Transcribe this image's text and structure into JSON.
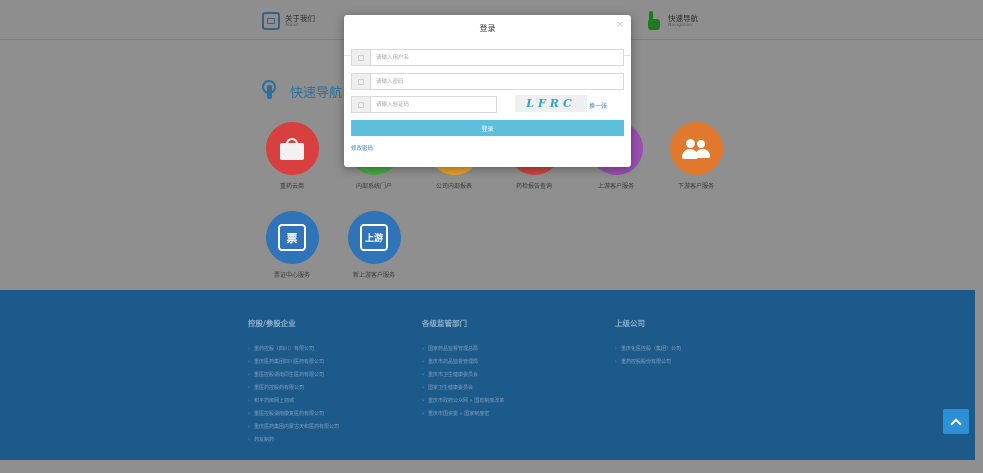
{
  "header": {
    "about": {
      "cn": "关于我们",
      "en": "About"
    },
    "quicknav": {
      "cn": "快速导航",
      "en": "Navigation"
    }
  },
  "quick_nav": {
    "title": "快速导航",
    "items": [
      {
        "label": "重药云商",
        "color": "#d84040",
        "icon": "shopping-bag-icon"
      },
      {
        "label": "内部系统门户",
        "color": "#48a844",
        "icon": "portal-icon"
      },
      {
        "label": "公司内部报表",
        "color": "#e8a228",
        "icon": "report-icon"
      },
      {
        "label": "药检报告查询",
        "color": "#c9463f",
        "icon": "search-report-icon"
      },
      {
        "label": "上游客户服务",
        "color": "#9a4fb2",
        "icon": "upstream-icon"
      },
      {
        "label": "下游客户服务",
        "color": "#e0782e",
        "icon": "people-icon"
      },
      {
        "label": "票证中心服务",
        "color": "#2f73b8",
        "glyph": "票",
        "icon": "ticket-icon"
      },
      {
        "label": "新上游客户服务",
        "color": "#2f73b8",
        "glyph": "上游",
        "icon": "new-upstream-icon"
      }
    ]
  },
  "footer": {
    "col1": {
      "title": "控股/参股企业",
      "items": [
        "重药控股（四川）有限公司",
        "重庆医药集团四川医药有限公司",
        "重医控股湖南同生医药有限公司",
        "重医药控股药有限公司",
        "和平药房网上商城",
        "重医控股湖南康复医药有限公司",
        "重庆医药集团内蒙古天和医药有限公司",
        "药友制药"
      ]
    },
    "col2": {
      "title": "各级监管部门",
      "items": [
        "国家药品监督管理总局",
        "重庆市药品监督管理局",
        "重庆市卫生健康委员会",
        "国家卫生健康委员会",
        "重庆市政府公众网 » 国有制度改革",
        "重庆市国资委 » 国家制度密"
      ]
    },
    "col3": {
      "title": "上级公司",
      "items": [
        "重庆化医控股（集团）公司",
        "重药控股股份有限公司"
      ]
    }
  },
  "modal": {
    "title": "登录",
    "close": "×",
    "username_placeholder": "请输入用户名",
    "password_placeholder": "请输入密码",
    "captcha_placeholder": "请输入验证码",
    "captcha_text": "LFRC",
    "refresh": "换一张",
    "login": "登录",
    "change_password": "修改密码"
  }
}
